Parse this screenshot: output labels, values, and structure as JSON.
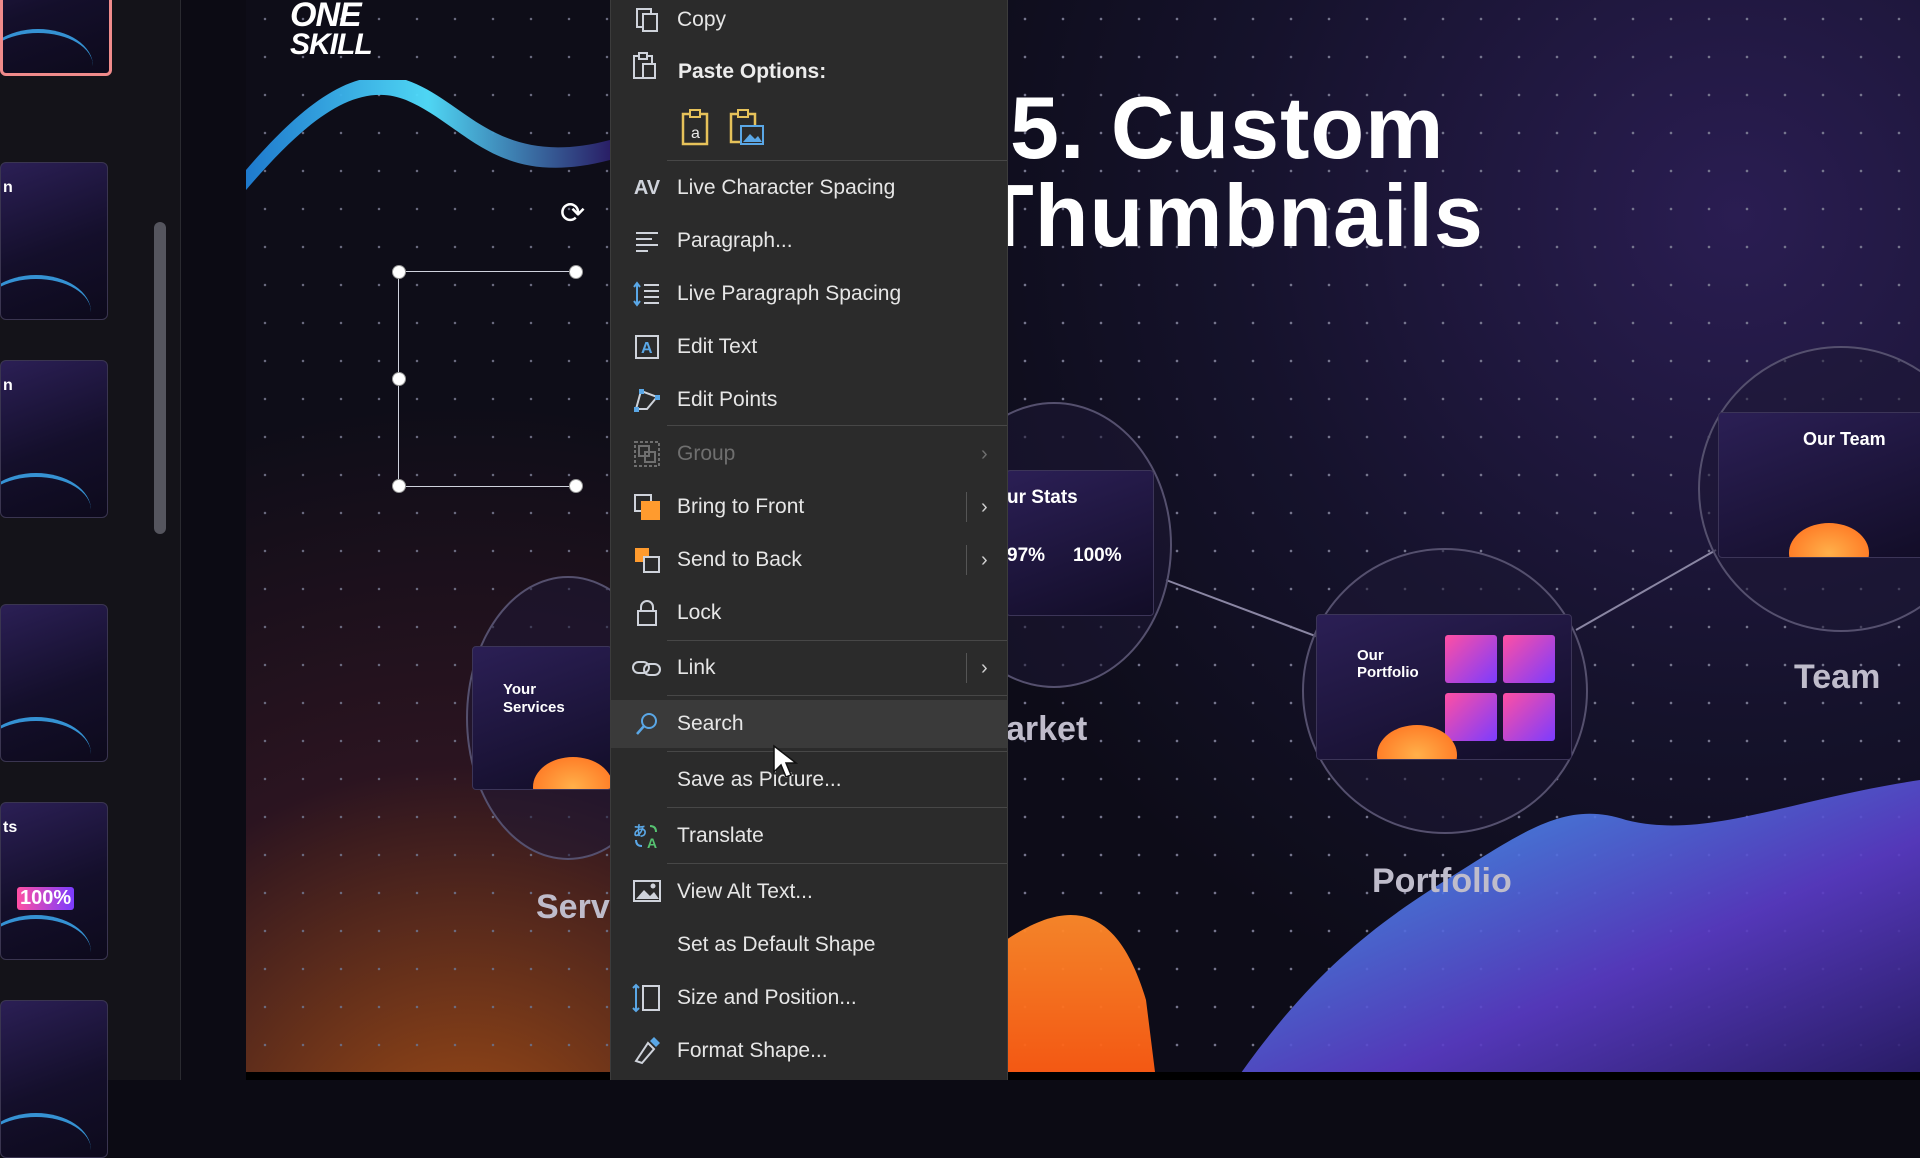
{
  "thumbnails": {
    "items": [
      {
        "label": ""
      },
      {
        "label": "n"
      },
      {
        "label": "n"
      },
      {
        "label": ""
      },
      {
        "label": "ts",
        "badge": "100%"
      },
      {
        "label": ""
      }
    ]
  },
  "slide": {
    "logo_line1": "ONE",
    "logo_line2": "SKILL",
    "title_line1": "5. Custom",
    "title_line2": "Thumbnails",
    "nodes": {
      "services": {
        "card_title_1": "Your",
        "card_title_2": "Services",
        "label": "Serv"
      },
      "stats": {
        "card_title": "ur Stats",
        "stat_a": "97%",
        "stat_b": "100%",
        "label": "arket"
      },
      "portfolio": {
        "card_title_1": "Our",
        "card_title_2": "Portfolio",
        "label": "Portfolio"
      },
      "team": {
        "card_title": "Our Team",
        "label": "Team"
      }
    }
  },
  "context_menu": {
    "copy": "Copy",
    "paste_options_title": "Paste Options:",
    "items": {
      "live_char_spacing": "Live Character Spacing",
      "paragraph": "Paragraph...",
      "live_para_spacing": "Live Paragraph Spacing",
      "edit_text": "Edit Text",
      "edit_points": "Edit Points",
      "group": "Group",
      "bring_to_front": "Bring to Front",
      "send_to_back": "Send to Back",
      "lock": "Lock",
      "link": "Link",
      "search": "Search",
      "save_as_picture": "Save as Picture...",
      "translate": "Translate",
      "view_alt_text": "View Alt Text...",
      "set_default_shape": "Set as Default Shape",
      "size_position": "Size and Position...",
      "format_shape": "Format Shape..."
    },
    "hovered": "search",
    "disabled": [
      "group"
    ]
  },
  "colors": {
    "menu_bg": "#2b2b2b",
    "menu_hover": "#3a3a3a",
    "selected_thumb_border": "#f08b8b",
    "accent_cyan": "#3fb4ff",
    "accent_orange": "#ff8a2a",
    "accent_purple": "#7b3cff"
  },
  "icons": {
    "copy": "copy-icon",
    "paste": "paste-icon",
    "char_spacing": "av-spacing-icon",
    "paragraph": "paragraph-icon",
    "para_spacing": "line-spacing-icon",
    "edit_text": "edit-text-icon",
    "edit_points": "edit-points-icon",
    "group": "group-icon",
    "front": "bring-front-icon",
    "back": "send-back-icon",
    "lock": "lock-icon",
    "link": "link-icon",
    "search": "search-icon",
    "translate": "translate-icon",
    "alt_text": "alt-text-icon",
    "size": "size-position-icon",
    "format": "format-shape-icon"
  }
}
